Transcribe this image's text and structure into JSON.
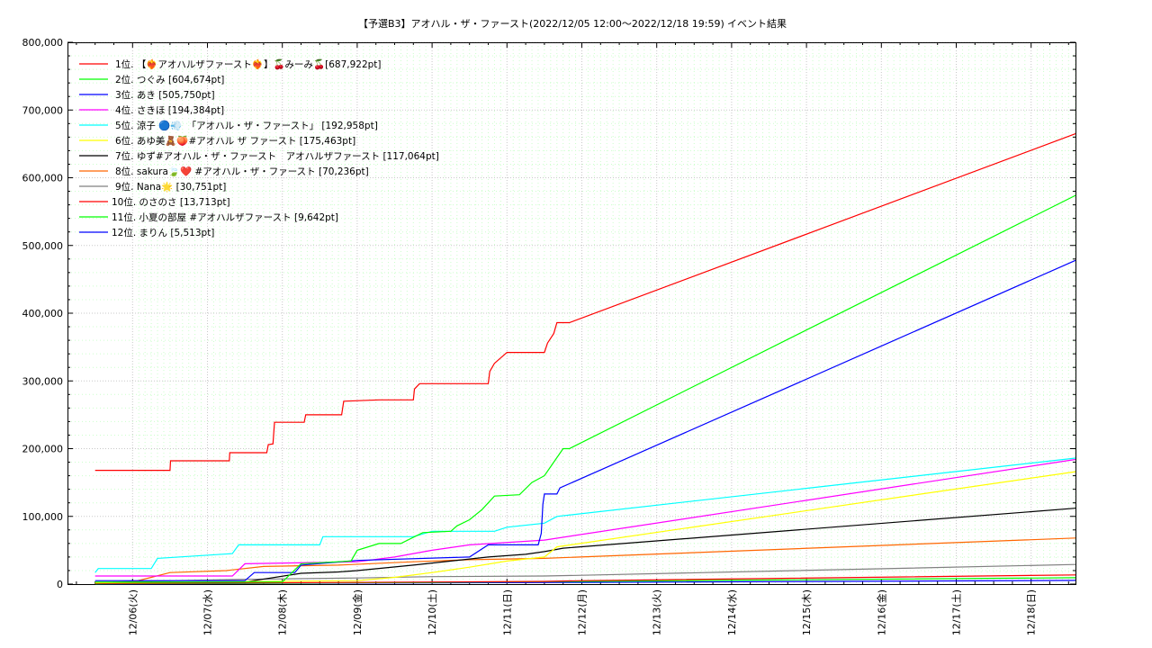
{
  "chart_data": {
    "type": "line",
    "title": "【予選B3】アオハル・ザ・ファースト(2022/12/05 12:00〜2022/12/18 19:59)",
    "title_right": "イベント結果",
    "x_start": "2022-12-05T12:00",
    "x_end": "2022-12-18T19:59",
    "x_tick_labels": [
      "12/06(火)",
      "12/07(水)",
      "12/08(木)",
      "12/09(金)",
      "12/10(土)",
      "12/11(日)",
      "12/12(月)",
      "12/13(火)",
      "12/14(水)",
      "12/15(木)",
      "12/16(金)",
      "12/17(土)",
      "12/18(日)"
    ],
    "y_tick_labels": [
      "0",
      "100,000",
      "200,000",
      "300,000",
      "400,000",
      "500,000",
      "600,000",
      "700,000",
      "800,000"
    ],
    "ylim": [
      0,
      800000
    ],
    "grid": true,
    "legend_position": "top-left",
    "series": [
      {
        "name": "1位. 【❤️‍🔥アオハルザファースト❤️‍🔥】🍒みーみ🍒[687,922pt]",
        "color": "#ff0000",
        "points": [
          [
            "12/05 12:00",
            168000
          ],
          [
            "12/06 12:00",
            168000
          ],
          [
            "12/06 12:10",
            182000
          ],
          [
            "12/07 07:00",
            182000
          ],
          [
            "12/07 07:10",
            194000
          ],
          [
            "12/07 19:00",
            194000
          ],
          [
            "12/07 19:30",
            206000
          ],
          [
            "12/07 21:00",
            207000
          ],
          [
            "12/07 21:30",
            239000
          ],
          [
            "12/08 07:00",
            239000
          ],
          [
            "12/08 07:30",
            250000
          ],
          [
            "12/08 19:00",
            250000
          ],
          [
            "12/08 19:40",
            270000
          ],
          [
            "12/09 07:00",
            272000
          ],
          [
            "12/09 18:00",
            272000
          ],
          [
            "12/09 18:20",
            288000
          ],
          [
            "12/09 20:00",
            296000
          ],
          [
            "12/10 18:00",
            296000
          ],
          [
            "12/10 18:30",
            314000
          ],
          [
            "12/10 20:00",
            326000
          ],
          [
            "12/11 00:00",
            342000
          ],
          [
            "12/11 12:00",
            342000
          ],
          [
            "12/11 13:00",
            356000
          ],
          [
            "12/11 15:00",
            370000
          ],
          [
            "12/11 16:00",
            386000
          ],
          [
            "12/11 20:00",
            386000
          ],
          [
            "12/18 19:59",
            665000
          ]
        ]
      },
      {
        "name": "2位. つぐみ [604,674pt]",
        "color": "#00ff00",
        "points": [
          [
            "12/05 12:00",
            3000
          ],
          [
            "12/08 00:00",
            3000
          ],
          [
            "12/08 06:00",
            30000
          ],
          [
            "12/08 22:00",
            34000
          ],
          [
            "12/09 00:00",
            50000
          ],
          [
            "12/09 07:00",
            60000
          ],
          [
            "12/09 14:00",
            60000
          ],
          [
            "12/09 21:00",
            76000
          ],
          [
            "12/10 06:00",
            78000
          ],
          [
            "12/10 08:00",
            86000
          ],
          [
            "12/10 12:00",
            95000
          ],
          [
            "12/10 16:00",
            110000
          ],
          [
            "12/10 20:00",
            130000
          ],
          [
            "12/11 04:00",
            132000
          ],
          [
            "12/11 08:00",
            150000
          ],
          [
            "12/11 12:00",
            160000
          ],
          [
            "12/11 15:00",
            180000
          ],
          [
            "12/11 18:00",
            200000
          ],
          [
            "12/11 20:00",
            200000
          ],
          [
            "12/18 19:59",
            574000
          ]
        ]
      },
      {
        "name": "3位. あき [505,750pt]",
        "color": "#0000ff",
        "points": [
          [
            "12/05 12:00",
            5000
          ],
          [
            "12/07 12:00",
            5000
          ],
          [
            "12/07 15:00",
            17000
          ],
          [
            "12/08 04:00",
            17000
          ],
          [
            "12/08 06:00",
            28000
          ],
          [
            "12/09 00:00",
            35000
          ],
          [
            "12/10 12:00",
            40000
          ],
          [
            "12/10 18:00",
            58000
          ],
          [
            "12/11 10:00",
            58000
          ],
          [
            "12/11 11:00",
            75000
          ],
          [
            "12/11 11:30",
            118000
          ],
          [
            "12/11 12:00",
            133000
          ],
          [
            "12/11 16:00",
            133000
          ],
          [
            "12/11 17:00",
            142000
          ],
          [
            "12/18 19:59",
            478000
          ]
        ]
      },
      {
        "name": "4位. さきほ [194,384pt]",
        "color": "#ff00ff",
        "points": [
          [
            "12/05 12:00",
            12000
          ],
          [
            "12/07 08:00",
            12000
          ],
          [
            "12/07 12:00",
            30000
          ],
          [
            "12/09 00:00",
            33000
          ],
          [
            "12/09 12:00",
            40000
          ],
          [
            "12/10 00:00",
            50000
          ],
          [
            "12/10 12:00",
            58000
          ],
          [
            "12/11 12:00",
            65000
          ],
          [
            "12/18 19:59",
            184000
          ]
        ]
      },
      {
        "name": "5位. 涼子 🔵💨　「アオハル・ザ・ファースト」 [192,958pt]",
        "color": "#00ffff",
        "points": [
          [
            "12/05 12:00",
            17000
          ],
          [
            "12/05 13:00",
            23000
          ],
          [
            "12/06 06:00",
            23000
          ],
          [
            "12/06 08:00",
            38000
          ],
          [
            "12/07 08:00",
            45000
          ],
          [
            "12/07 10:00",
            58000
          ],
          [
            "12/08 12:00",
            58000
          ],
          [
            "12/08 13:00",
            70000
          ],
          [
            "12/09 18:00",
            70000
          ],
          [
            "12/10 00:00",
            78000
          ],
          [
            "12/10 20:00",
            78000
          ],
          [
            "12/11 00:00",
            84000
          ],
          [
            "12/11 12:00",
            90000
          ],
          [
            "12/11 16:00",
            100000
          ],
          [
            "12/18 19:59",
            186000
          ]
        ]
      },
      {
        "name": "6位. あゆ美🧸🍑#アオハル ザ ファースト [175,463pt]",
        "color": "#ffff00",
        "points": [
          [
            "12/05 12:00",
            2000
          ],
          [
            "12/09 00:00",
            5000
          ],
          [
            "12/09 12:00",
            10000
          ],
          [
            "12/10 00:00",
            17000
          ],
          [
            "12/10 12:00",
            25000
          ],
          [
            "12/11 00:00",
            34000
          ],
          [
            "12/11 12:00",
            40000
          ],
          [
            "12/11 16:00",
            55000
          ],
          [
            "12/18 19:59",
            166000
          ]
        ]
      },
      {
        "name": "7位. ゆず#アオハル・ザ・ファースト　アオハルザファースト [117,064pt]",
        "color": "#000000",
        "points": [
          [
            "12/05 12:00",
            2000
          ],
          [
            "12/07 12:00",
            3000
          ],
          [
            "12/08 06:00",
            16000
          ],
          [
            "12/08 18:00",
            18000
          ],
          [
            "12/09 00:00",
            20000
          ],
          [
            "12/09 18:00",
            28000
          ],
          [
            "12/10 06:00",
            34000
          ],
          [
            "12/10 18:00",
            40000
          ],
          [
            "12/11 06:00",
            44000
          ],
          [
            "12/11 12:00",
            48000
          ],
          [
            "12/11 18:00",
            53000
          ],
          [
            "12/18 19:59",
            112000
          ]
        ]
      },
      {
        "name": "8位. sakura🍃❤️ #アオハル・ザ・ファースト [70,236pt]",
        "color": "#ff6600",
        "points": [
          [
            "12/05 12:00",
            2000
          ],
          [
            "12/06 00:00",
            3000
          ],
          [
            "12/06 06:00",
            10000
          ],
          [
            "12/06 12:00",
            17000
          ],
          [
            "12/07 06:00",
            20000
          ],
          [
            "12/07 18:00",
            26000
          ],
          [
            "12/08 18:00",
            28000
          ],
          [
            "12/09 18:00",
            33000
          ],
          [
            "12/10 12:00",
            36000
          ],
          [
            "12/11 12:00",
            38000
          ],
          [
            "12/18 19:59",
            68000
          ]
        ]
      },
      {
        "name": "9位. Nana🌟 [30,751pt]",
        "color": "#808080",
        "points": [
          [
            "12/05 12:00",
            2000
          ],
          [
            "12/06 00:00",
            4000
          ],
          [
            "12/07 12:00",
            7000
          ],
          [
            "12/09 00:00",
            9000
          ],
          [
            "12/10 00:00",
            11000
          ],
          [
            "12/11 12:00",
            12000
          ],
          [
            "12/12 00:00",
            13000
          ],
          [
            "12/18 19:59",
            29000
          ]
        ]
      },
      {
        "name": "10位. のさのさ [13,713pt]",
        "color": "#ff0000",
        "points": [
          [
            "12/05 12:00",
            1000
          ],
          [
            "12/08 00:00",
            2000
          ],
          [
            "12/10 00:00",
            3000
          ],
          [
            "12/11 12:00",
            4000
          ],
          [
            "12/12 00:00",
            5000
          ],
          [
            "12/18 19:59",
            13500
          ]
        ]
      },
      {
        "name": "11位. 小夏の部屋 #アオハルザファースト [9,642pt]",
        "color": "#00ff00",
        "points": [
          [
            "12/05 12:00",
            500
          ],
          [
            "12/08 00:00",
            1500
          ],
          [
            "12/10 00:00",
            2500
          ],
          [
            "12/12 00:00",
            4000
          ],
          [
            "12/18 19:59",
            9500
          ]
        ]
      },
      {
        "name": "12位. まりん [5,513pt]",
        "color": "#0000ff",
        "points": [
          [
            "12/05 12:00",
            300
          ],
          [
            "12/08 00:00",
            1000
          ],
          [
            "12/10 00:00",
            1800
          ],
          [
            "12/12 00:00",
            2500
          ],
          [
            "12/18 19:59",
            5500
          ]
        ]
      }
    ]
  }
}
